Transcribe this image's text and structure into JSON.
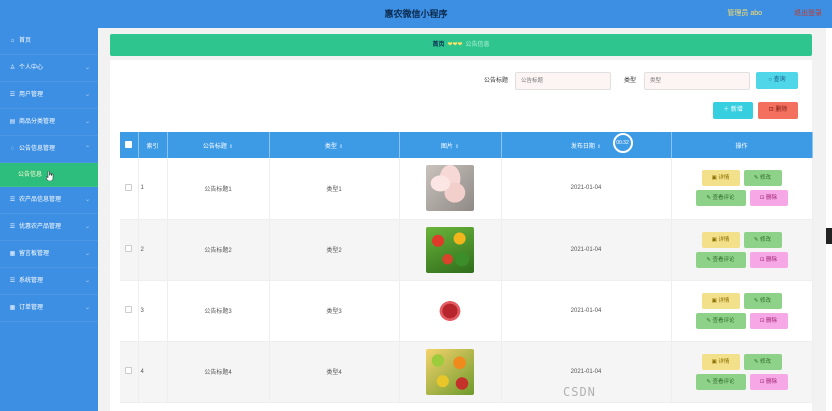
{
  "header": {
    "title": "惠农微信小程序",
    "admin": "管理员 abo",
    "logout": "退出登录"
  },
  "sidebar": {
    "items": [
      {
        "icon": "⌂",
        "label": "首页",
        "arrow": ""
      },
      {
        "icon": "♙",
        "label": "个人中心",
        "arrow": "⌄"
      },
      {
        "icon": "☰",
        "label": "用户管理",
        "arrow": "⌄"
      },
      {
        "icon": "▤",
        "label": "商品分类管理",
        "arrow": "⌄"
      },
      {
        "icon": "◌",
        "label": "公告信息管理",
        "arrow": "⌃"
      },
      {
        "icon": "",
        "label": "公告信息",
        "arrow": ""
      },
      {
        "icon": "☰",
        "label": "农产品信息管理",
        "arrow": "⌄"
      },
      {
        "icon": "☰",
        "label": "优惠农产品管理",
        "arrow": "⌄"
      },
      {
        "icon": "▦",
        "label": "留言板管理",
        "arrow": "⌄"
      },
      {
        "icon": "☰",
        "label": "系统管理",
        "arrow": "⌄"
      },
      {
        "icon": "▦",
        "label": "订单管理",
        "arrow": "⌄"
      }
    ]
  },
  "breadcrumb": {
    "home": "首页",
    "separator": "❤❤❤",
    "current": "公告信息"
  },
  "search": {
    "title_label": "公告标题",
    "title_placeholder": "公告标题",
    "type_label": "类型",
    "type_placeholder": "类型",
    "query_button": "○ 查询"
  },
  "actions": {
    "add": "＋ 新增",
    "delete": "⊡ 删除"
  },
  "table": {
    "columns": {
      "index": "索引",
      "title": "公告标题",
      "type": "类型",
      "image": "图片",
      "date": "发布日期",
      "ops": "操作"
    },
    "timer_badge": "00:32",
    "rows": [
      {
        "index": "1",
        "title": "公告标题1",
        "type": "类型1",
        "date": "2021-01-04",
        "image": "meat-photo"
      },
      {
        "index": "2",
        "title": "公告标题2",
        "type": "类型2",
        "date": "2021-01-04",
        "image": "vegetables-photo"
      },
      {
        "index": "3",
        "title": "公告标题3",
        "type": "类型3",
        "date": "2021-01-04",
        "image": "steak-plate-photo"
      },
      {
        "index": "4",
        "title": "公告标题4",
        "type": "类型4",
        "date": "2021-01-04",
        "image": "fruits-photo"
      }
    ],
    "op_labels": {
      "detail": "▣ 详情",
      "edit": "✎ 修改",
      "comment": "✎ 查看评论",
      "delete": "⊡ 删除"
    }
  },
  "watermark": "CSDN",
  "colors": {
    "accent_blue": "#3d8fe3",
    "crumb_green": "#2fc58f",
    "add_btn": "#36cfe0",
    "del_btn": "#f36f5e"
  }
}
